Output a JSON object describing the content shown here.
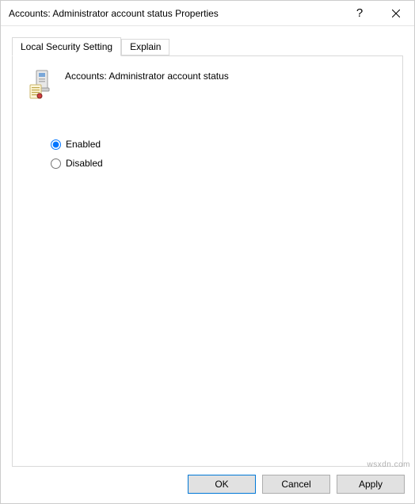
{
  "titlebar": {
    "title": "Accounts: Administrator account status Properties",
    "help_label": "?",
    "close_label": "Close"
  },
  "tabs": {
    "local_security": "Local Security Setting",
    "explain": "Explain"
  },
  "panel": {
    "policy_title": "Accounts: Administrator account status",
    "options": {
      "enabled": "Enabled",
      "disabled": "Disabled"
    },
    "selected": "enabled"
  },
  "buttons": {
    "ok": "OK",
    "cancel": "Cancel",
    "apply": "Apply"
  },
  "watermark": "wsxdn.com"
}
